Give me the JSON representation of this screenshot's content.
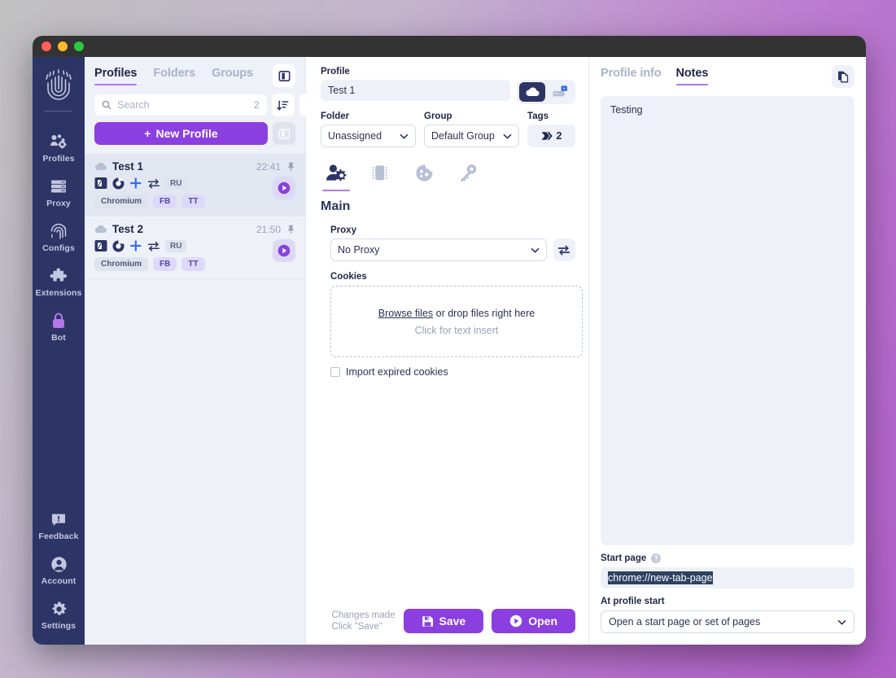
{
  "window": {
    "traffic_lights": [
      "close",
      "minimize",
      "maximize"
    ]
  },
  "rail": {
    "logo": "fingerprint-logo",
    "items": [
      {
        "label": "Profiles",
        "icon": "profiles-icon",
        "active": true
      },
      {
        "label": "Proxy",
        "icon": "server-icon",
        "active": false
      },
      {
        "label": "Configs",
        "icon": "fingerprint-icon",
        "active": false
      },
      {
        "label": "Extensions",
        "icon": "puzzle-icon",
        "active": false
      },
      {
        "label": "Bot",
        "icon": "lock-icon",
        "active": false
      }
    ],
    "bottom_items": [
      {
        "label": "Feedback",
        "icon": "feedback-icon"
      },
      {
        "label": "Account",
        "icon": "account-icon"
      },
      {
        "label": "Settings",
        "icon": "gear-icon"
      }
    ]
  },
  "list_panel": {
    "tabs": [
      {
        "label": "Profiles",
        "active": true
      },
      {
        "label": "Folders",
        "active": false
      },
      {
        "label": "Groups",
        "active": false
      }
    ],
    "layout_toggle_icon": "panel-layout-icon",
    "search": {
      "placeholder": "Search",
      "value": "",
      "count": "2",
      "icon": "search-icon"
    },
    "sort_icon": "sort-desc-icon",
    "filter_icon": "filter-icon",
    "new_profile_label": "New Profile",
    "new_profile_plus": "+",
    "columns_toggle_icon": "columns-icon",
    "profiles": [
      {
        "name": "Test 1",
        "time": "22:41",
        "cloud_icon": "cloud-icon",
        "pin_icon": "pin-icon",
        "status_icons": [
          "window-icon",
          "chromium-icon",
          "plus-icon",
          "transfer-icon"
        ],
        "locale": "RU",
        "tags": [
          "Chromium",
          "FB",
          "TT"
        ],
        "play_icon": "play-icon",
        "selected": true
      },
      {
        "name": "Test 2",
        "time": "21:50",
        "cloud_icon": "cloud-icon",
        "pin_icon": "pin-icon",
        "status_icons": [
          "window-icon",
          "chromium-icon",
          "plus-icon",
          "transfer-icon"
        ],
        "locale": "RU",
        "tags": [
          "Chromium",
          "FB",
          "TT"
        ],
        "play_icon": "play-icon",
        "selected": false
      }
    ]
  },
  "form": {
    "profile_label": "Profile",
    "profile_value": "Test 1",
    "storage_toggle": {
      "cloud_icon": "cloud-icon",
      "local_icon": "local-storage-icon",
      "lock_badge_icon": "lock-badge-icon",
      "active": "cloud"
    },
    "folder_label": "Folder",
    "folder_value": "Unassigned",
    "group_label": "Group",
    "group_value": "Default Group",
    "tags_label": "Tags",
    "tags_count": "2",
    "tags_icon": "tag-icon",
    "icon_tabs": [
      {
        "icon": "user-settings-icon",
        "active": true
      },
      {
        "icon": "chip-icon",
        "active": false
      },
      {
        "icon": "cookie-icon",
        "active": false
      },
      {
        "icon": "key-icon",
        "active": false
      }
    ],
    "section_title": "Main",
    "proxy_label": "Proxy",
    "proxy_value": "No Proxy",
    "proxy_swap_icon": "swap-icon",
    "cookies_label": "Cookies",
    "dropzone_link": "Browse files",
    "dropzone_text": " or drop files right here",
    "dropzone_sub": "Click for text insert",
    "import_expired_label": "Import expired cookies",
    "import_expired_checked": false,
    "changes_line1": "Changes made",
    "changes_line2": "Click \"Save\"",
    "save_label": "Save",
    "save_icon": "save-icon",
    "open_label": "Open",
    "open_icon": "play-icon"
  },
  "notes_panel": {
    "tabs": [
      {
        "label": "Profile info",
        "active": false
      },
      {
        "label": "Notes",
        "active": true
      }
    ],
    "copy_icon": "copy-icon",
    "notes_text": "Testing",
    "start_page_label": "Start page",
    "start_page_help_icon": "help-icon",
    "start_page_help_glyph": "?",
    "start_page_value": "chrome://new-tab-page",
    "at_profile_start_label": "At profile start",
    "at_profile_start_value": "Open a start page or set of pages"
  },
  "colors": {
    "accent_purple": "#8b3fe0",
    "rail_navy": "#2d3566",
    "panel_bg": "#eef1f7",
    "tab_underline": "#b277e8",
    "selection_blue": "#2d4263"
  }
}
